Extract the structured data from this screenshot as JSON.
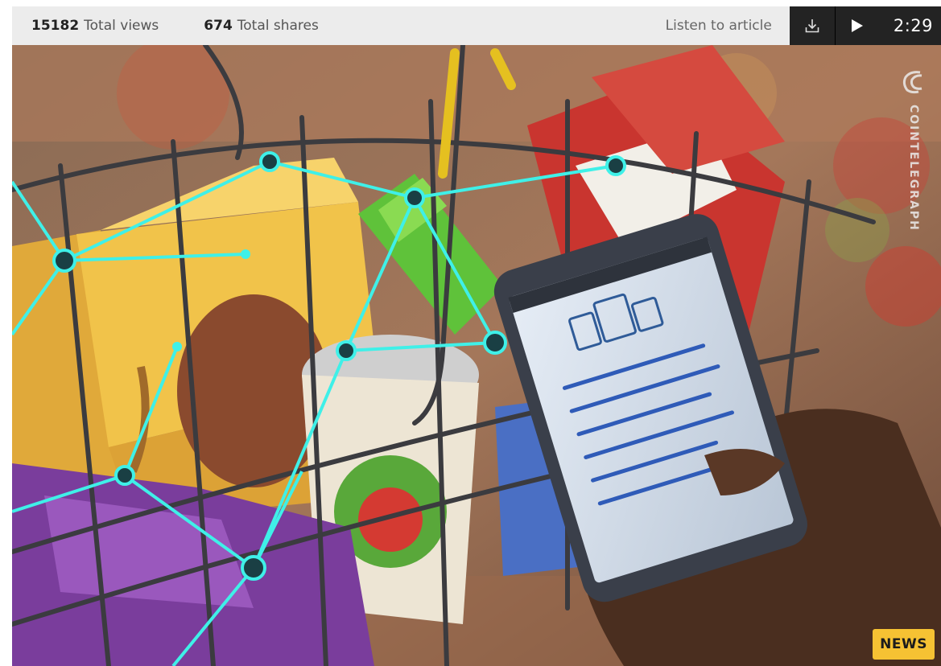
{
  "stats": {
    "views_count": "15182",
    "views_label": "Total views",
    "shares_count": "674",
    "shares_label": "Total shares"
  },
  "audio": {
    "listen_label": "Listen to article",
    "download_icon": "download-icon",
    "play_icon": "play-icon",
    "duration": "2:29"
  },
  "hero": {
    "watermark_icon": "cointelegraph-logo-icon",
    "watermark_text": "COINTELEGRAPH",
    "badge": "NEWS"
  },
  "colors": {
    "player_bg": "#232323",
    "stats_bg": "#ececec",
    "badge_bg": "#f6c233",
    "network_line": "#3ff0e8"
  }
}
